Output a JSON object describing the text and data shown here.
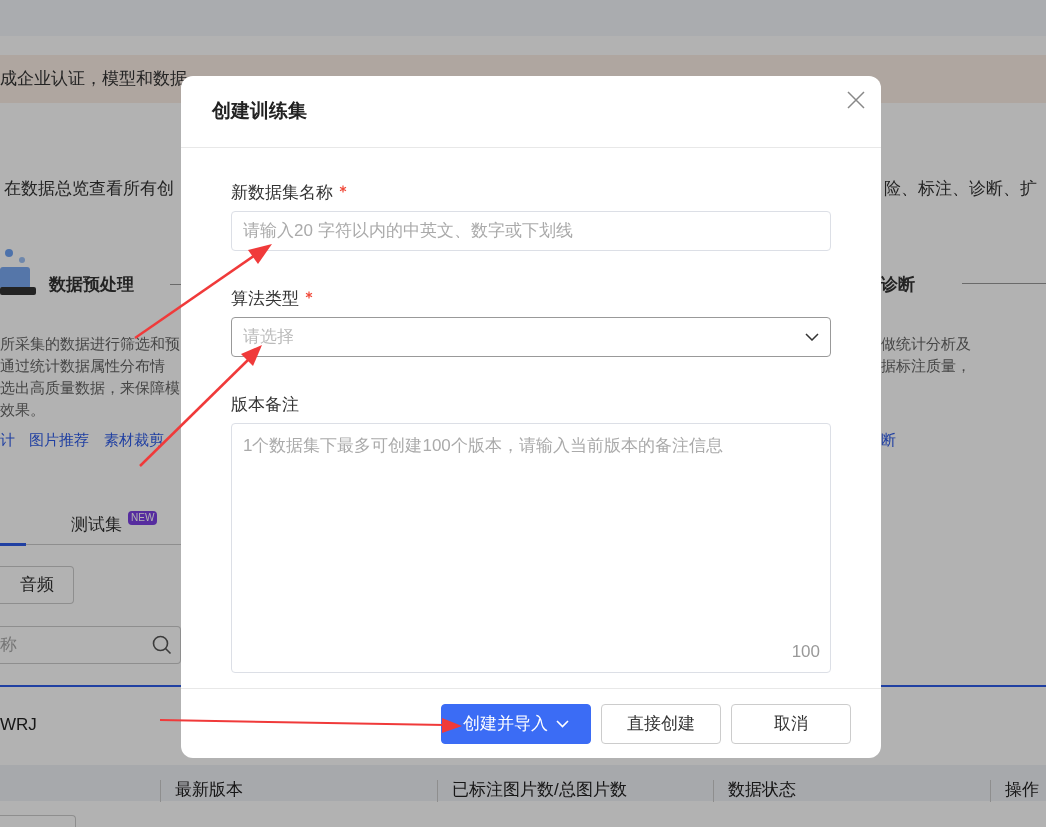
{
  "banner": {
    "text": "成企业认证，模型和数据"
  },
  "intro": {
    "left": "在数据总览查看所有创",
    "right": "险、标注、诊断、扩"
  },
  "cards": [
    {
      "title": "数据预处理",
      "lines": [
        "所采集的数据进行筛选和预",
        "通过统计数据属性分布情",
        "选出高质量数据，来保障模",
        "效果。"
      ],
      "links": [
        "计",
        "图片推荐",
        "素材裁剪"
      ]
    },
    {
      "title": "诊断",
      "lines": [
        "做统计分析及",
        "据标注质量，"
      ],
      "links": [
        "断"
      ]
    }
  ],
  "tabs": [
    {
      "selected": true
    },
    {
      "label": "测试集",
      "badge": "NEW",
      "selected": false
    }
  ],
  "filter_button": "音频",
  "search": {
    "placeholder": "称"
  },
  "row": {
    "name": "WRJ"
  },
  "table": {
    "columns": [
      "最新版本",
      "已标注图片数/总图片数",
      "数据状态",
      "操作"
    ]
  },
  "dialog": {
    "title": "创建训练集",
    "fields": [
      {
        "kind": "input",
        "label": "新数据集名称",
        "required": true,
        "placeholder": "请输入20 字符以内的中英文、数字或下划线"
      },
      {
        "kind": "select",
        "label": "算法类型",
        "required": true,
        "placeholder": "请选择"
      },
      {
        "kind": "textarea",
        "label": "版本备注",
        "required": false,
        "placeholder": "1个数据集下最多可创建100个版本，请输入当前版本的备注信息",
        "counter": "100"
      }
    ],
    "buttons": [
      {
        "label": "创建并导入",
        "kind": "primary",
        "dropdown": true
      },
      {
        "label": "直接创建",
        "kind": "default",
        "dropdown": false
      },
      {
        "label": "取消",
        "kind": "default",
        "dropdown": false
      }
    ]
  }
}
